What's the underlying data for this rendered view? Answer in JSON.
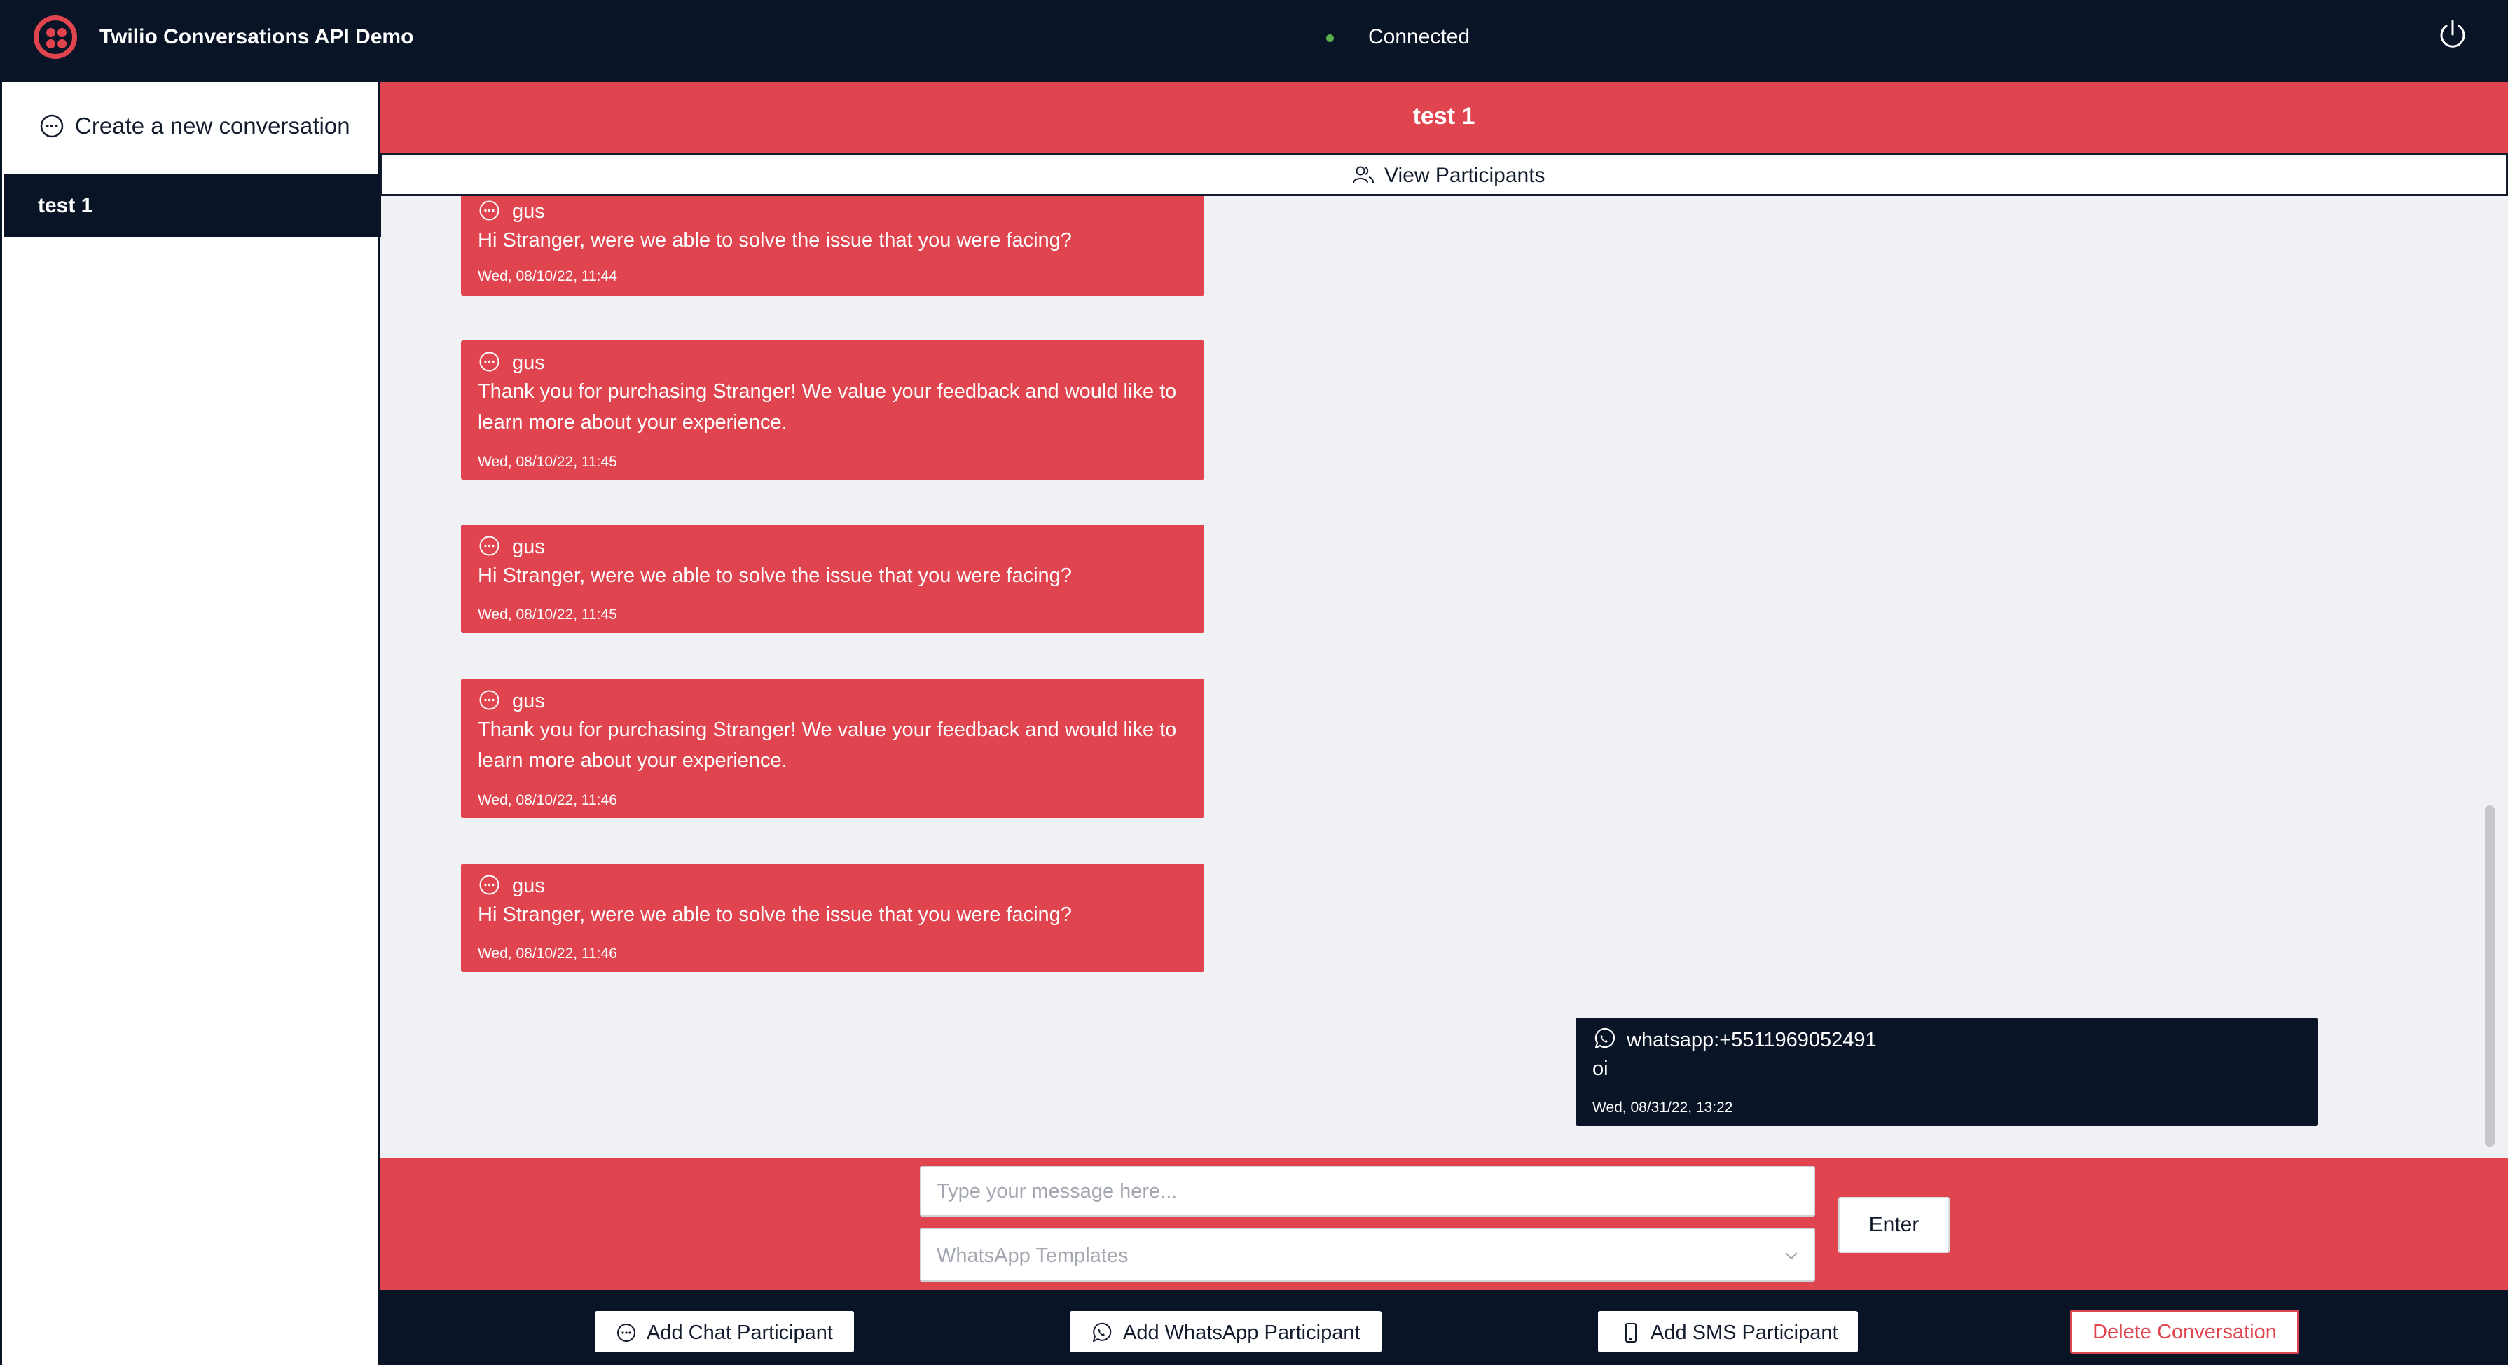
{
  "app": {
    "title": "Twilio Conversations API Demo",
    "status": "Connected",
    "logo_icon": "twilio-logo",
    "power_icon": "power-icon"
  },
  "colors": {
    "brand_red": "#e0444f",
    "navy": "#091526",
    "status_green": "#5ab04a",
    "background": "#f0f1f4"
  },
  "sidebar": {
    "new_conversation_label": "Create a new conversation",
    "conversations": [
      {
        "name": "test 1",
        "selected": true
      }
    ]
  },
  "conversation": {
    "title": "test 1",
    "view_participants_label": "View Participants"
  },
  "messages": [
    {
      "author": "gus",
      "channel": "chat",
      "body": "Hi Stranger, were we able to solve the issue that you were facing?",
      "time": "Wed, 08/10/22, 11:44",
      "direction": "incoming"
    },
    {
      "author": "gus",
      "channel": "chat",
      "body": "Thank you for purchasing Stranger! We value your feedback and would like to learn more about your experience.",
      "time": "Wed, 08/10/22, 11:45",
      "direction": "incoming"
    },
    {
      "author": "gus",
      "channel": "chat",
      "body": "Hi Stranger, were we able to solve the issue that you were facing?",
      "time": "Wed, 08/10/22, 11:45",
      "direction": "incoming"
    },
    {
      "author": "gus",
      "channel": "chat",
      "body": "Thank you for purchasing Stranger! We value your feedback and would like to learn more about your experience.",
      "time": "Wed, 08/10/22, 11:46",
      "direction": "incoming"
    },
    {
      "author": "gus",
      "channel": "chat",
      "body": "Hi Stranger, were we able to solve the issue that you were facing?",
      "time": "Wed, 08/10/22, 11:46",
      "direction": "incoming"
    },
    {
      "author": "whatsapp:+5511969052491",
      "channel": "whatsapp",
      "body": "oi",
      "time": "Wed, 08/31/22, 13:22",
      "direction": "outgoing"
    }
  ],
  "composer": {
    "message_placeholder": "Type your message here...",
    "templates_placeholder": "WhatsApp Templates",
    "enter_label": "Enter"
  },
  "actions": {
    "add_chat_label": "Add Chat Participant",
    "add_whatsapp_label": "Add WhatsApp Participant",
    "add_sms_label": "Add SMS Participant",
    "delete_label": "Delete Conversation"
  }
}
